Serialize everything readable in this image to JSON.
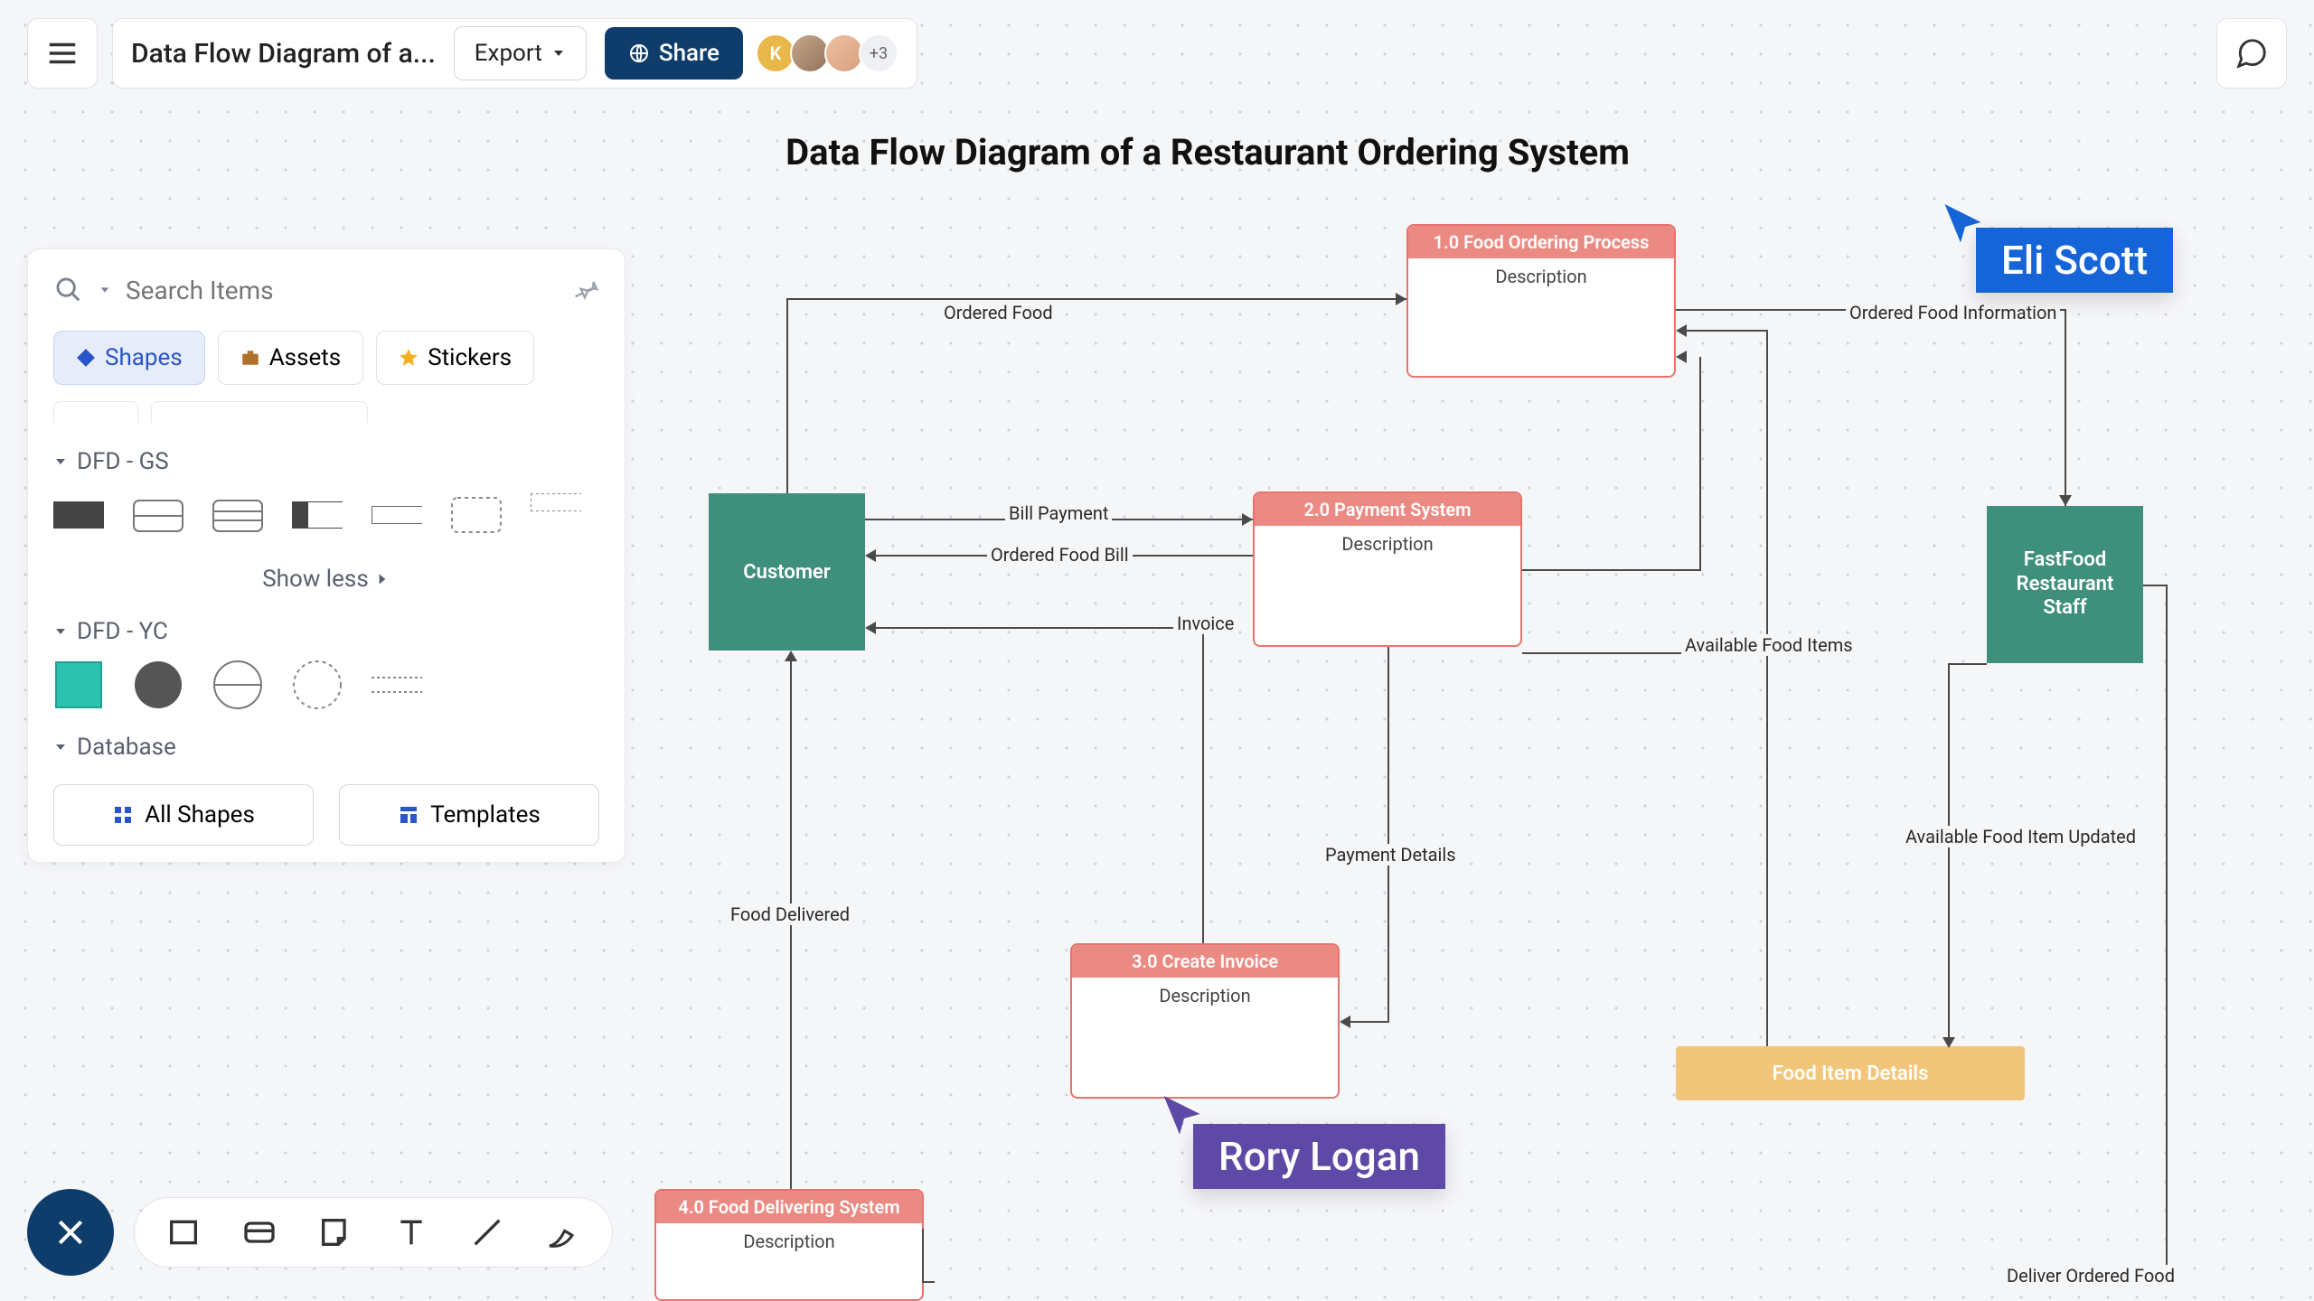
{
  "document": {
    "title": "Data Flow Diagram of a..."
  },
  "toolbar": {
    "export_label": "Export",
    "share_label": "Share",
    "avatar_letter": "K",
    "avatar_more": "+3"
  },
  "canvas": {
    "title": "Data Flow Diagram of a Restaurant Ordering System"
  },
  "left_panel": {
    "search_placeholder": "Search Items",
    "tabs": {
      "shapes": "Shapes",
      "assets": "Assets",
      "stickers": "Stickers"
    },
    "sections": {
      "dfd_gs": "DFD - GS",
      "dfd_yc": "DFD - YC",
      "database": "Database"
    },
    "show_less": "Show less",
    "footer": {
      "all_shapes": "All Shapes",
      "templates": "Templates"
    }
  },
  "nodes": {
    "customer": "Customer",
    "staff_line1": "FastFood",
    "staff_line2": "Restaurant",
    "staff_line3": "Staff",
    "process1_header": "1.0  Food Ordering Process",
    "process1_body": "Description",
    "process2_header": "2.0 Payment System",
    "process2_body": "Description",
    "process3_header": "3.0 Create Invoice",
    "process3_body": "Description",
    "process4_header": "4.0 Food Delivering System",
    "process4_body": "Description",
    "datastore": "Food Item Details"
  },
  "edges": {
    "ordered_food": "Ordered Food",
    "ordered_food_info": "Ordered Food Information",
    "bill_payment": "Bill Payment",
    "ordered_food_bill": "Ordered Food Bill",
    "invoice": "Invoice",
    "available_food_items": "Available Food Items",
    "payment_details": "Payment Details",
    "food_delivered": "Food Delivered",
    "available_food_updated": "Available Food Item Updated",
    "deliver_ordered_food": "Deliver Ordered Food"
  },
  "collaborators": {
    "eli": "Eli Scott",
    "rory": "Rory Logan"
  }
}
